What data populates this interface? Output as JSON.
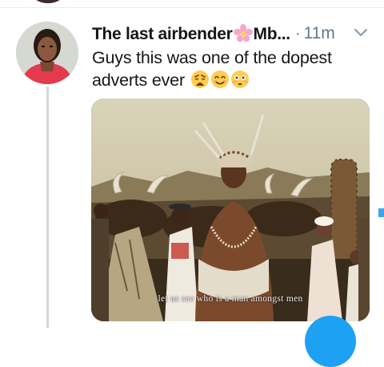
{
  "tweet": {
    "display_name": "The last airbender",
    "name_emoji": "flower-emoji",
    "name_suffix": "Mb...",
    "separator": "·",
    "timestamp": "11m",
    "text": "Guys this was one of the dopest adverts ever",
    "text_emojis": [
      "weary-face-emoji",
      "smiling-face-emoji",
      "flushed-face-emoji"
    ],
    "media": {
      "subtitle": "let us see who is a man amongst men"
    }
  },
  "colors": {
    "text": "#14171a",
    "muted": "#657786",
    "accent": "#1da1f2",
    "thread_line": "#cfd9de"
  },
  "icons": {
    "menu": "chevron-down-icon",
    "compose": "compose-fab"
  }
}
